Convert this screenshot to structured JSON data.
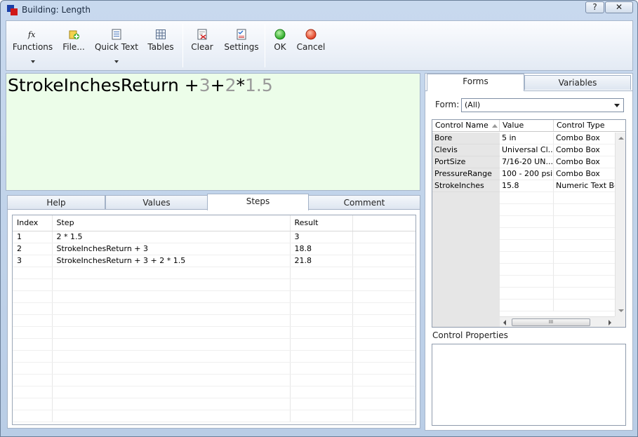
{
  "window": {
    "title": "Building: Length",
    "help_label": "?",
    "close_label": "✕"
  },
  "toolbar": {
    "functions": "Functions",
    "file": "File...",
    "quick_text": "Quick Text",
    "tables": "Tables",
    "clear": "Clear",
    "settings": "Settings",
    "ok": "OK",
    "cancel": "Cancel"
  },
  "expression": {
    "identifier": "StrokeInchesReturn",
    "plus1": " +",
    "num1": "3",
    "plus2": "+",
    "num2": "2",
    "times": "*",
    "num3": "1.5"
  },
  "left_tabs": {
    "help": "Help",
    "values": "Values",
    "steps": "Steps",
    "comment": "Comment"
  },
  "steps_table": {
    "headers": {
      "index": "Index",
      "step": "Step",
      "result": "Result"
    },
    "rows": [
      {
        "index": "1",
        "step": "2 * 1.5",
        "result": "3"
      },
      {
        "index": "2",
        "step": "StrokeInchesReturn + 3",
        "result": "18.8"
      },
      {
        "index": "3",
        "step": "StrokeInchesReturn + 3 + 2 * 1.5",
        "result": "21.8"
      }
    ]
  },
  "right_tabs": {
    "forms": "Forms",
    "variables": "Variables"
  },
  "form_filter": {
    "label": "Form:",
    "value": "(All)"
  },
  "controls_table": {
    "headers": {
      "name": "Control Name",
      "value": "Value",
      "type": "Control Type"
    },
    "rows": [
      {
        "name": "Bore",
        "value": "5 in",
        "type": "Combo Box"
      },
      {
        "name": "Clevis",
        "value": "Universal Cl...",
        "type": "Combo Box"
      },
      {
        "name": "PortSize",
        "value": "7/16-20 UN...",
        "type": "Combo Box"
      },
      {
        "name": "PressureRange",
        "value": "100 - 200 psi",
        "type": "Combo Box"
      },
      {
        "name": "StrokeInches",
        "value": "15.8",
        "type": "Numeric Text Box"
      }
    ],
    "scroll_thumb": "III"
  },
  "control_properties": {
    "label": "Control Properties"
  },
  "icons": {
    "functions": "fx-icon",
    "file": "file-add-icon",
    "quick_text": "quick-text-icon",
    "tables": "table-icon",
    "clear": "clear-icon",
    "settings": "settings-checklist-icon",
    "ok": "green-circle-icon",
    "cancel": "red-circle-icon"
  },
  "colors": {
    "expression_bg": "#ecfde9",
    "number_gray": "#9a9a9a",
    "ok_green": "#2fb52f",
    "cancel_red": "#e2432a"
  }
}
